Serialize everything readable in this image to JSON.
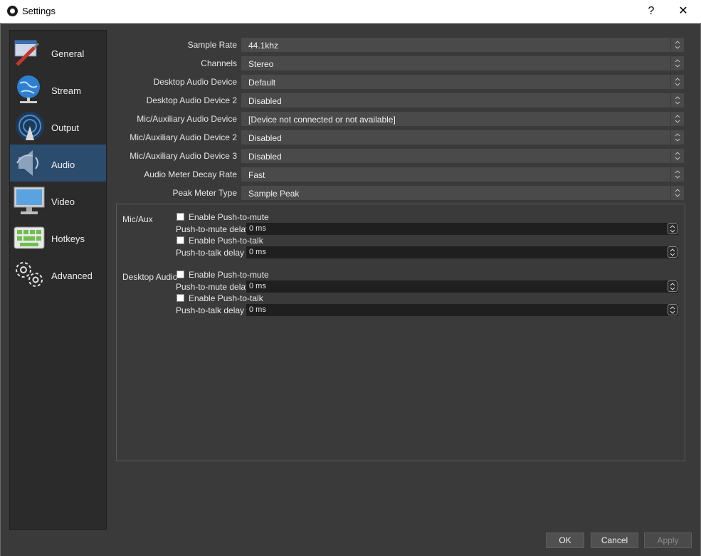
{
  "window": {
    "title": "Settings",
    "help_label": "?",
    "close_label": "✕"
  },
  "sidebar": {
    "items": [
      {
        "label": "General",
        "icon": "general-icon"
      },
      {
        "label": "Stream",
        "icon": "stream-icon"
      },
      {
        "label": "Output",
        "icon": "output-icon"
      },
      {
        "label": "Audio",
        "icon": "audio-icon",
        "active": true
      },
      {
        "label": "Video",
        "icon": "video-icon"
      },
      {
        "label": "Hotkeys",
        "icon": "hotkeys-icon"
      },
      {
        "label": "Advanced",
        "icon": "advanced-icon"
      }
    ]
  },
  "audio": {
    "fields": [
      {
        "label": "Sample Rate",
        "value": "44.1khz"
      },
      {
        "label": "Channels",
        "value": "Stereo"
      },
      {
        "label": "Desktop Audio Device",
        "value": "Default"
      },
      {
        "label": "Desktop Audio Device 2",
        "value": "Disabled"
      },
      {
        "label": "Mic/Auxiliary Audio Device",
        "value": "[Device not connected or not available]"
      },
      {
        "label": "Mic/Auxiliary Audio Device 2",
        "value": "Disabled"
      },
      {
        "label": "Mic/Auxiliary Audio Device 3",
        "value": "Disabled"
      },
      {
        "label": "Audio Meter Decay Rate",
        "value": "Fast"
      },
      {
        "label": "Peak Meter Type",
        "value": "Sample Peak"
      }
    ]
  },
  "hotkeys": {
    "groups": [
      {
        "name": "Mic/Aux",
        "push_to_mute_label": "Enable Push-to-mute",
        "push_to_mute_delay_label": "Push-to-mute delay",
        "push_to_mute_delay_value": "0 ms",
        "push_to_talk_label": "Enable Push-to-talk",
        "push_to_talk_delay_label": "Push-to-talk delay",
        "push_to_talk_delay_value": "0 ms"
      },
      {
        "name": "Desktop Audio",
        "push_to_mute_label": "Enable Push-to-mute",
        "push_to_mute_delay_label": "Push-to-mute delay",
        "push_to_mute_delay_value": "0 ms",
        "push_to_talk_label": "Enable Push-to-talk",
        "push_to_talk_delay_label": "Push-to-talk delay",
        "push_to_talk_delay_value": "0 ms"
      }
    ]
  },
  "footer": {
    "ok_label": "OK",
    "cancel_label": "Cancel",
    "apply_label": "Apply"
  }
}
